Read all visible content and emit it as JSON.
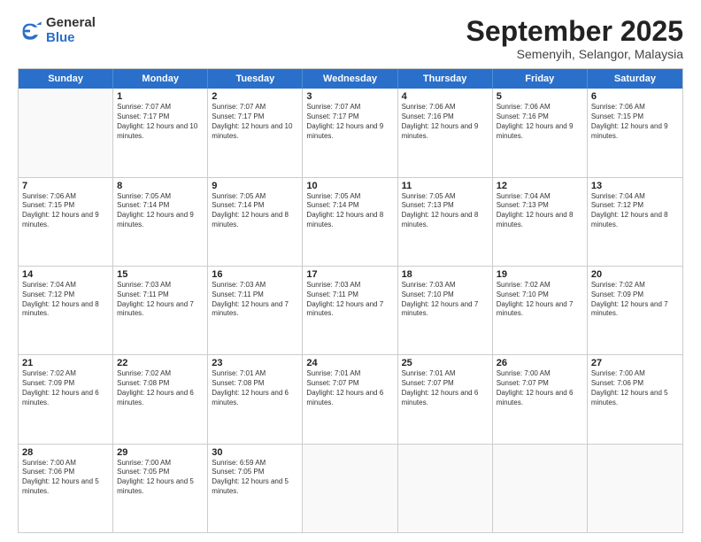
{
  "logo": {
    "general": "General",
    "blue": "Blue"
  },
  "header": {
    "month": "September 2025",
    "location": "Semenyih, Selangor, Malaysia"
  },
  "days": [
    "Sunday",
    "Monday",
    "Tuesday",
    "Wednesday",
    "Thursday",
    "Friday",
    "Saturday"
  ],
  "weeks": [
    [
      {
        "day": "",
        "sunrise": "",
        "sunset": "",
        "daylight": ""
      },
      {
        "day": "1",
        "sunrise": "Sunrise: 7:07 AM",
        "sunset": "Sunset: 7:17 PM",
        "daylight": "Daylight: 12 hours and 10 minutes."
      },
      {
        "day": "2",
        "sunrise": "Sunrise: 7:07 AM",
        "sunset": "Sunset: 7:17 PM",
        "daylight": "Daylight: 12 hours and 10 minutes."
      },
      {
        "day": "3",
        "sunrise": "Sunrise: 7:07 AM",
        "sunset": "Sunset: 7:17 PM",
        "daylight": "Daylight: 12 hours and 9 minutes."
      },
      {
        "day": "4",
        "sunrise": "Sunrise: 7:06 AM",
        "sunset": "Sunset: 7:16 PM",
        "daylight": "Daylight: 12 hours and 9 minutes."
      },
      {
        "day": "5",
        "sunrise": "Sunrise: 7:06 AM",
        "sunset": "Sunset: 7:16 PM",
        "daylight": "Daylight: 12 hours and 9 minutes."
      },
      {
        "day": "6",
        "sunrise": "Sunrise: 7:06 AM",
        "sunset": "Sunset: 7:15 PM",
        "daylight": "Daylight: 12 hours and 9 minutes."
      }
    ],
    [
      {
        "day": "7",
        "sunrise": "Sunrise: 7:06 AM",
        "sunset": "Sunset: 7:15 PM",
        "daylight": "Daylight: 12 hours and 9 minutes."
      },
      {
        "day": "8",
        "sunrise": "Sunrise: 7:05 AM",
        "sunset": "Sunset: 7:14 PM",
        "daylight": "Daylight: 12 hours and 9 minutes."
      },
      {
        "day": "9",
        "sunrise": "Sunrise: 7:05 AM",
        "sunset": "Sunset: 7:14 PM",
        "daylight": "Daylight: 12 hours and 8 minutes."
      },
      {
        "day": "10",
        "sunrise": "Sunrise: 7:05 AM",
        "sunset": "Sunset: 7:14 PM",
        "daylight": "Daylight: 12 hours and 8 minutes."
      },
      {
        "day": "11",
        "sunrise": "Sunrise: 7:05 AM",
        "sunset": "Sunset: 7:13 PM",
        "daylight": "Daylight: 12 hours and 8 minutes."
      },
      {
        "day": "12",
        "sunrise": "Sunrise: 7:04 AM",
        "sunset": "Sunset: 7:13 PM",
        "daylight": "Daylight: 12 hours and 8 minutes."
      },
      {
        "day": "13",
        "sunrise": "Sunrise: 7:04 AM",
        "sunset": "Sunset: 7:12 PM",
        "daylight": "Daylight: 12 hours and 8 minutes."
      }
    ],
    [
      {
        "day": "14",
        "sunrise": "Sunrise: 7:04 AM",
        "sunset": "Sunset: 7:12 PM",
        "daylight": "Daylight: 12 hours and 8 minutes."
      },
      {
        "day": "15",
        "sunrise": "Sunrise: 7:03 AM",
        "sunset": "Sunset: 7:11 PM",
        "daylight": "Daylight: 12 hours and 7 minutes."
      },
      {
        "day": "16",
        "sunrise": "Sunrise: 7:03 AM",
        "sunset": "Sunset: 7:11 PM",
        "daylight": "Daylight: 12 hours and 7 minutes."
      },
      {
        "day": "17",
        "sunrise": "Sunrise: 7:03 AM",
        "sunset": "Sunset: 7:11 PM",
        "daylight": "Daylight: 12 hours and 7 minutes."
      },
      {
        "day": "18",
        "sunrise": "Sunrise: 7:03 AM",
        "sunset": "Sunset: 7:10 PM",
        "daylight": "Daylight: 12 hours and 7 minutes."
      },
      {
        "day": "19",
        "sunrise": "Sunrise: 7:02 AM",
        "sunset": "Sunset: 7:10 PM",
        "daylight": "Daylight: 12 hours and 7 minutes."
      },
      {
        "day": "20",
        "sunrise": "Sunrise: 7:02 AM",
        "sunset": "Sunset: 7:09 PM",
        "daylight": "Daylight: 12 hours and 7 minutes."
      }
    ],
    [
      {
        "day": "21",
        "sunrise": "Sunrise: 7:02 AM",
        "sunset": "Sunset: 7:09 PM",
        "daylight": "Daylight: 12 hours and 6 minutes."
      },
      {
        "day": "22",
        "sunrise": "Sunrise: 7:02 AM",
        "sunset": "Sunset: 7:08 PM",
        "daylight": "Daylight: 12 hours and 6 minutes."
      },
      {
        "day": "23",
        "sunrise": "Sunrise: 7:01 AM",
        "sunset": "Sunset: 7:08 PM",
        "daylight": "Daylight: 12 hours and 6 minutes."
      },
      {
        "day": "24",
        "sunrise": "Sunrise: 7:01 AM",
        "sunset": "Sunset: 7:07 PM",
        "daylight": "Daylight: 12 hours and 6 minutes."
      },
      {
        "day": "25",
        "sunrise": "Sunrise: 7:01 AM",
        "sunset": "Sunset: 7:07 PM",
        "daylight": "Daylight: 12 hours and 6 minutes."
      },
      {
        "day": "26",
        "sunrise": "Sunrise: 7:00 AM",
        "sunset": "Sunset: 7:07 PM",
        "daylight": "Daylight: 12 hours and 6 minutes."
      },
      {
        "day": "27",
        "sunrise": "Sunrise: 7:00 AM",
        "sunset": "Sunset: 7:06 PM",
        "daylight": "Daylight: 12 hours and 5 minutes."
      }
    ],
    [
      {
        "day": "28",
        "sunrise": "Sunrise: 7:00 AM",
        "sunset": "Sunset: 7:06 PM",
        "daylight": "Daylight: 12 hours and 5 minutes."
      },
      {
        "day": "29",
        "sunrise": "Sunrise: 7:00 AM",
        "sunset": "Sunset: 7:05 PM",
        "daylight": "Daylight: 12 hours and 5 minutes."
      },
      {
        "day": "30",
        "sunrise": "Sunrise: 6:59 AM",
        "sunset": "Sunset: 7:05 PM",
        "daylight": "Daylight: 12 hours and 5 minutes."
      },
      {
        "day": "",
        "sunrise": "",
        "sunset": "",
        "daylight": ""
      },
      {
        "day": "",
        "sunrise": "",
        "sunset": "",
        "daylight": ""
      },
      {
        "day": "",
        "sunrise": "",
        "sunset": "",
        "daylight": ""
      },
      {
        "day": "",
        "sunrise": "",
        "sunset": "",
        "daylight": ""
      }
    ]
  ]
}
